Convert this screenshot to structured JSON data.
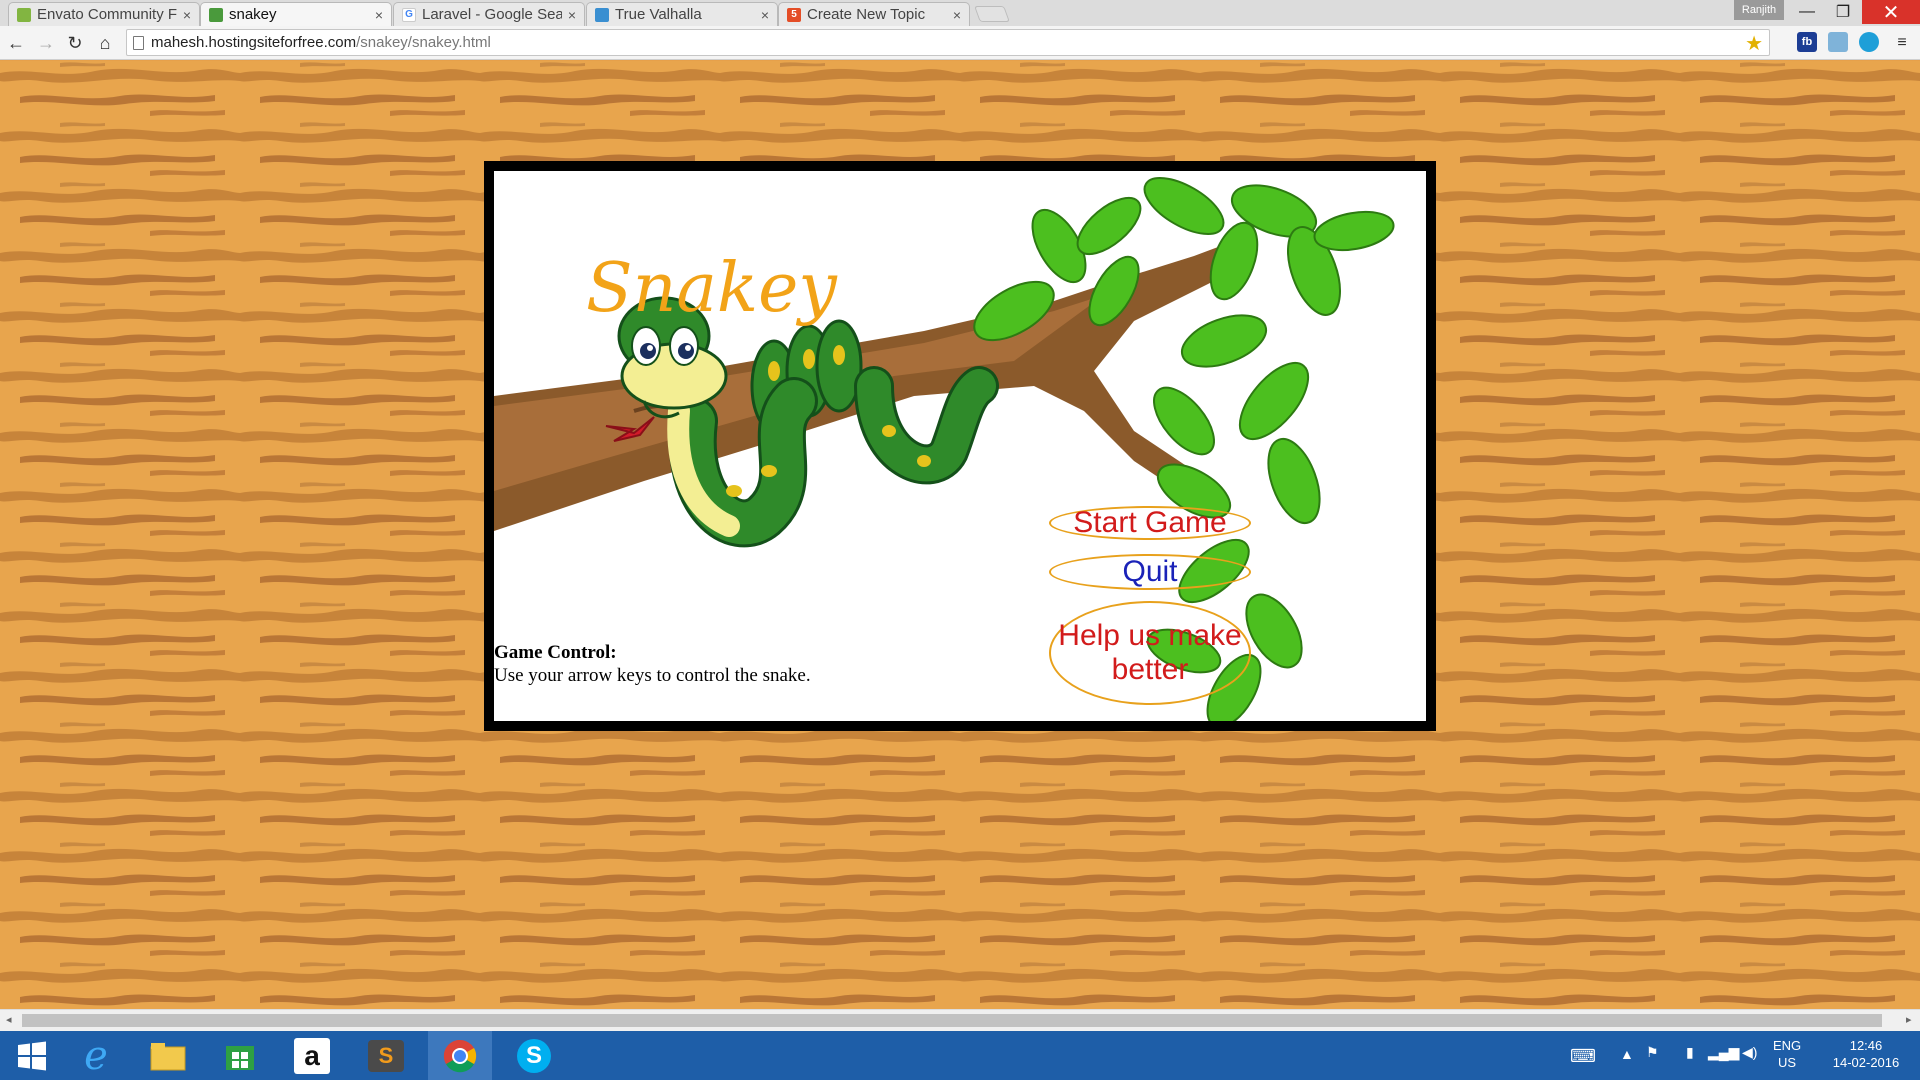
{
  "browser": {
    "tabs": [
      {
        "title": "Envato Community F",
        "favicon_color": "#82b541"
      },
      {
        "title": "snakey",
        "favicon_color": "#4a9a3c",
        "active": true
      },
      {
        "title": "Laravel - Google Sea",
        "favicon_color": "#4285f4"
      },
      {
        "title": "True Valhalla",
        "favicon_color": "#3a8fd1"
      },
      {
        "title": "Create New Topic",
        "favicon_color": "#e44d26"
      }
    ],
    "user_badge": "Ranjith",
    "url_host": "mahesh.hostingsiteforfree.com",
    "url_path": "/snakey/snakey.html",
    "extensions": [
      "fb"
    ]
  },
  "game": {
    "title": "Snakey",
    "menu": {
      "start": "Start Game",
      "quit": "Quit",
      "help": "Help us make better"
    },
    "controls_heading": "Game Control:",
    "controls_text": "Use your arrow keys to control the snake."
  },
  "taskbar": {
    "lang_top": "ENG",
    "lang_bottom": "US",
    "time": "12:46",
    "date": "14-02-2016"
  },
  "colors": {
    "title": "#f2a318",
    "menu_red": "#d21b1b",
    "menu_blue": "#1a22b8",
    "menu_border": "#e8a11c",
    "wood": "#e8a54d",
    "taskbar": "#1e5ea8"
  }
}
